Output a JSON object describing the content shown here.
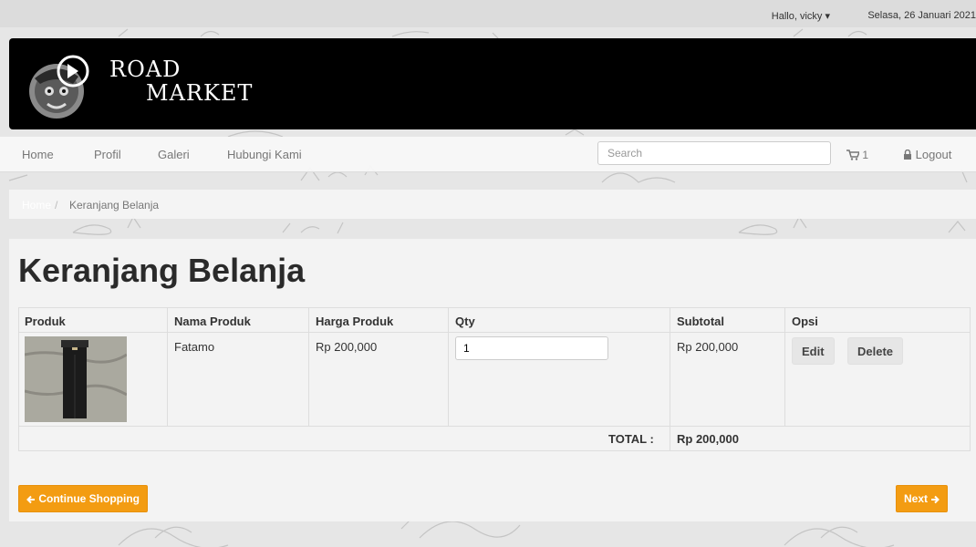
{
  "topbar": {
    "greeting": "Hallo, vicky",
    "date": "Selasa, 26 Januari 2021"
  },
  "brand": {
    "line1": "ROAD",
    "line2": "MARKET"
  },
  "nav": {
    "items": [
      "Home",
      "Profil",
      "Galeri",
      "Hubungi Kami"
    ],
    "search_placeholder": "Search",
    "cart_count": "1",
    "logout": "Logout"
  },
  "breadcrumb": {
    "home": "Home",
    "separator": "/",
    "current": "Keranjang Belanja"
  },
  "page": {
    "title": "Keranjang Belanja"
  },
  "cart_table": {
    "headers": [
      "Produk",
      "Nama Produk",
      "Harga Produk",
      "Qty",
      "Subtotal",
      "Opsi"
    ],
    "rows": [
      {
        "image": "product-thumbnail",
        "name": "Fatamo",
        "price": "Rp 200,000",
        "qty": "1",
        "subtotal": "Rp 200,000",
        "edit": "Edit",
        "delete": "Delete"
      }
    ],
    "total_label": "TOTAL :",
    "total_value": "Rp 200,000"
  },
  "actions": {
    "continue": "Continue Shopping",
    "next": "Next"
  },
  "colors": {
    "accent": "#f39c12",
    "header_bg": "#000000"
  }
}
